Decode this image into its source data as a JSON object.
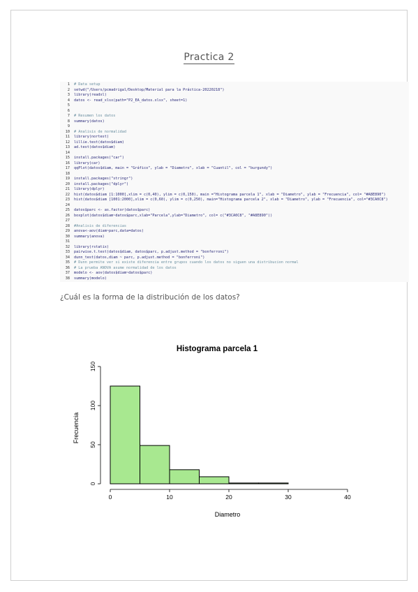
{
  "document": {
    "title": "Practica 2",
    "question": "¿Cuál es la forma de la distribución de los datos?"
  },
  "code_lines": [
    {
      "n": "1",
      "text": "# Data setup",
      "comment": true
    },
    {
      "n": "2",
      "text": "setwd(\"/Users/pcmadrigal/Desktop/Material para la Práctica-20220218\")",
      "comment": false
    },
    {
      "n": "3",
      "text": "library(readxl)",
      "comment": false
    },
    {
      "n": "4",
      "text": "datos <- read_xlsx(path=\"P2_EA_datos.xlsx\", sheet=1)",
      "comment": false
    },
    {
      "n": "5",
      "text": "",
      "comment": false
    },
    {
      "n": "6",
      "text": "",
      "comment": false
    },
    {
      "n": "7",
      "text": "# Resumen los datos",
      "comment": true
    },
    {
      "n": "8",
      "text": "summary(datos)",
      "comment": false
    },
    {
      "n": "9",
      "text": "",
      "comment": false
    },
    {
      "n": "10",
      "text": "# Analisis de normalidad",
      "comment": true
    },
    {
      "n": "11",
      "text": "library(nortest)",
      "comment": false
    },
    {
      "n": "12",
      "text": "lillie.test(datos$diam)",
      "comment": false
    },
    {
      "n": "13",
      "text": "ad.test(datos$diam)",
      "comment": false
    },
    {
      "n": "14",
      "text": "",
      "comment": false
    },
    {
      "n": "15",
      "text": "install.packages(\"car\")",
      "comment": false
    },
    {
      "n": "16",
      "text": "library(car)",
      "comment": false
    },
    {
      "n": "17",
      "text": "qqPlot(datos$diam, main = \"Gráfico\", ylab = \"Diametro\", xlab = \"Cuantil\", col = \"burgundy\")",
      "comment": false
    },
    {
      "n": "18",
      "text": "",
      "comment": false
    },
    {
      "n": "19",
      "text": "install.packages(\"stringr\")",
      "comment": false
    },
    {
      "n": "20",
      "text": "install.packages(\"dplyr\")",
      "comment": false
    },
    {
      "n": "21",
      "text": "library(dplyr)",
      "comment": false
    },
    {
      "n": "22",
      "text": "hist(datos$diam [1:1000],xlim = c(0,40), ylim = c(0,150), main =\"Histograma parcela 1\", xlab = \"Diametro\", ylab = \"Frecuencia\", col= \"#A8E890\")",
      "comment": false
    },
    {
      "n": "23",
      "text": "hist(datos$diam [1001:2000],xlim = c(0,60), ylim = c(0,250), main=\"Histograma parcela 2\", xlab = \"Diametro\", ylab = \"Frecuencia\", col=\"#3CA0C8\")",
      "comment": false
    },
    {
      "n": "24",
      "text": "",
      "comment": false
    },
    {
      "n": "25",
      "text": "datos$parc <- as.factor(datos$parc)",
      "comment": false
    },
    {
      "n": "26",
      "text": "boxplot(datos$diam~datos$parc,xlab=\"Parcela\",ylab=\"Diametro\", col= c(\"#3CA0C8\", \"#A8E890\"))",
      "comment": false
    },
    {
      "n": "27",
      "text": "",
      "comment": false
    },
    {
      "n": "28",
      "text": "#Analisis de diferencias",
      "comment": true
    },
    {
      "n": "29",
      "text": "anova<-aov(diam~parc,data=datos)",
      "comment": false
    },
    {
      "n": "30",
      "text": "summary(anova)",
      "comment": false
    },
    {
      "n": "31",
      "text": "",
      "comment": false
    },
    {
      "n": "32",
      "text": "library(rstatix)",
      "comment": false
    },
    {
      "n": "33",
      "text": "pairwise.t.test(datos$diam, datos$parc, p.adjust.method = \"bonferroni\")",
      "comment": false
    },
    {
      "n": "34",
      "text": "dunn_test(datos,diam ~ parc, p.adjust.method = \"bonferroni\")",
      "comment": false
    },
    {
      "n": "35",
      "text": "# Dunn permite ver si existe diferencia entre grupos cuando los datos no siguen una distribucion normal",
      "comment": true
    },
    {
      "n": "36",
      "text": "# La prueba ANOVA asume normalidad de los datos",
      "comment": true
    },
    {
      "n": "37",
      "text": "modelo <- aov(datos$diam~datos$parc)",
      "comment": false
    },
    {
      "n": "38",
      "text": "summary(modelo)",
      "comment": false
    }
  ],
  "colors": {
    "bar_fill": "#A8E890",
    "code_text": "#2a2a7a",
    "code_comment": "#6a8fa0"
  },
  "chart_data": {
    "type": "bar",
    "title": "Histograma parcela 1",
    "xlabel": "Diametro",
    "ylabel": "Frecuencia",
    "bins": [
      {
        "x0": 0,
        "x1": 5,
        "count": 125
      },
      {
        "x0": 5,
        "x1": 10,
        "count": 49
      },
      {
        "x0": 10,
        "x1": 15,
        "count": 18
      },
      {
        "x0": 15,
        "x1": 20,
        "count": 9
      },
      {
        "x0": 20,
        "x1": 25,
        "count": 1
      },
      {
        "x0": 25,
        "x1": 30,
        "count": 1
      }
    ],
    "xlim": [
      0,
      40
    ],
    "ylim": [
      0,
      150
    ],
    "xticks": [
      "0",
      "10",
      "20",
      "30",
      "40"
    ],
    "yticks": [
      "0",
      "50",
      "100",
      "150"
    ],
    "grid": false
  }
}
